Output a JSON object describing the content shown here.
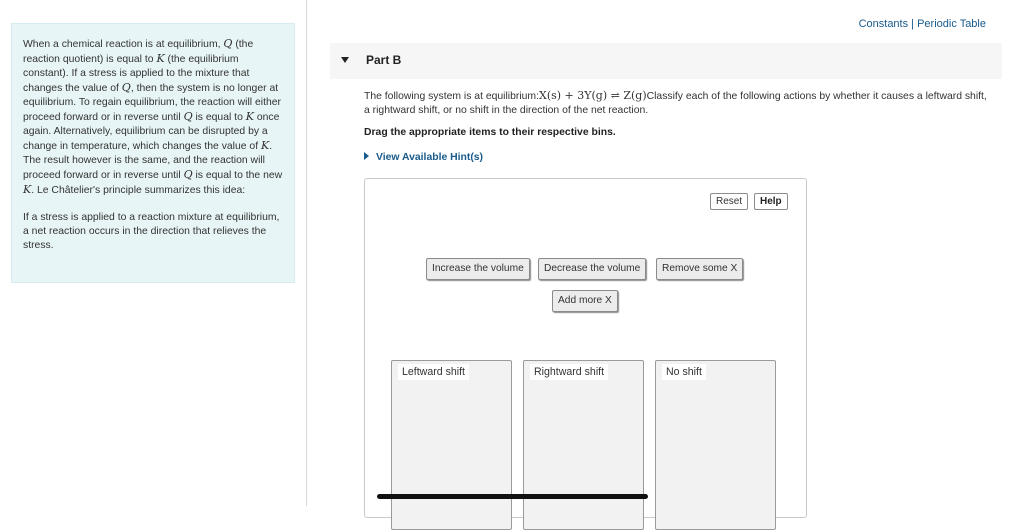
{
  "top_links": {
    "constants": "Constants",
    "separator": "|",
    "periodic_table": "Periodic Table"
  },
  "info_panel": {
    "p1": [
      "When a chemical reaction is at equilibrium, ",
      "Q",
      " (the reaction quotient) is equal to ",
      "K",
      " (the equilibrium constant). If a stress is applied to the mixture that changes the value of ",
      "Q",
      ", then the system is no longer at equilibrium. To regain equilibrium, the reaction will either proceed forward or in reverse until ",
      "Q",
      " is equal to ",
      "K",
      " once again. Alternatively, equilibrium can be disrupted by a change in temperature, which changes the value of ",
      "K",
      ". The result however is the same, and the reaction will proceed forward or in reverse until ",
      "Q",
      " is equal to the new ",
      "K",
      ". Le Châtelier's principle summarizes this idea:"
    ],
    "p2": "If a stress is applied to a reaction mixture at equilibrium, a net reaction occurs in the direction that relieves the stress."
  },
  "part": {
    "title": "Part B"
  },
  "question": {
    "intro": "The following system is at equilibrium:",
    "equation": "X(s) + 3Y(g) ⇌ Z(g)",
    "text": "Classify each of the following actions by whether it causes a leftward shift, a rightward shift, or no shift in the direction of the net reaction.",
    "instruction": "Drag the appropriate items to their respective bins.",
    "hint": "View Available Hint(s)"
  },
  "workspace": {
    "reset_label": "Reset",
    "help_label": "Help",
    "items": [
      "Increase the volume",
      "Decrease the volume",
      "Remove some X",
      "Add more X"
    ],
    "bins": [
      "Leftward shift",
      "Rightward shift",
      "No shift"
    ]
  }
}
